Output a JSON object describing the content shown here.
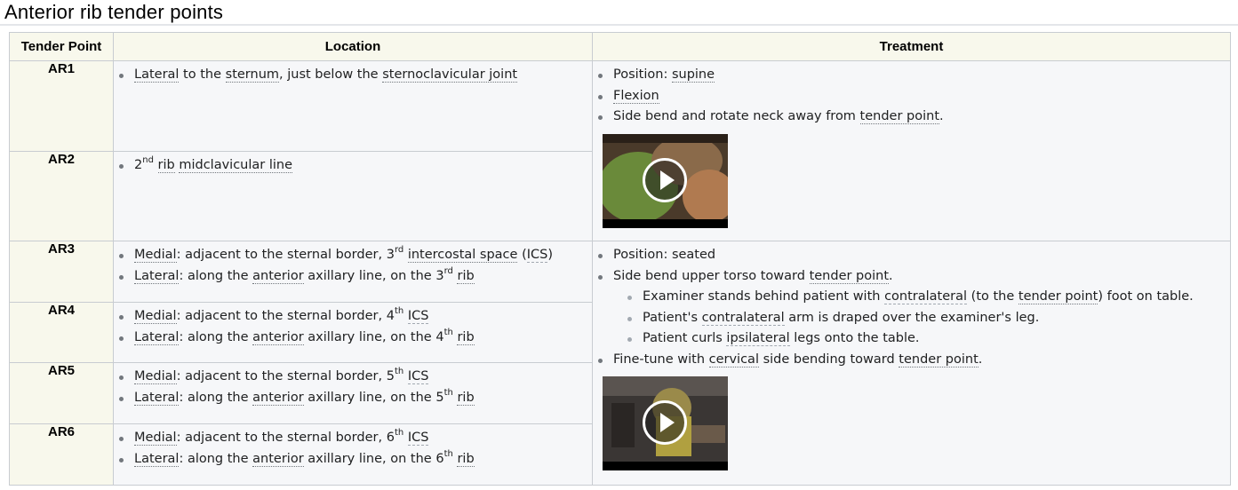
{
  "page": {
    "title": "Anterior rib tender points"
  },
  "table": {
    "headers": {
      "tender_point": "Tender Point",
      "location": "Location",
      "treatment": "Treatment"
    },
    "rows": [
      {
        "name": "AR1",
        "location": [
          {
            "parts": [
              "Lateral",
              " to the ",
              "sternum",
              ", just below the ",
              "sternoclavicular joint"
            ]
          }
        ]
      },
      {
        "name": "AR2",
        "location": [
          {
            "ordinal": "2",
            "suffix": "nd",
            "word1": "rib",
            "word2": "midclavicular line"
          }
        ]
      },
      {
        "name": "AR3",
        "location": [
          {
            "prefix": "Medial",
            "text": ": adjacent to the sternal border, ",
            "ordinal": "3",
            "suffix": "rd",
            "term": "intercostal space",
            "abbr": "ICS"
          },
          {
            "prefix": "Lateral",
            "text1": ": along the ",
            "term": "anterior",
            "text2": " axillary line, on the ",
            "ordinal": "3",
            "suffix": "rd",
            "end": "rib"
          }
        ]
      },
      {
        "name": "AR4",
        "location": [
          {
            "prefix": "Medial",
            "text": ": adjacent to the sternal border, ",
            "ordinal": "4",
            "suffix": "th",
            "abbr": "ICS"
          },
          {
            "prefix": "Lateral",
            "text1": ": along the ",
            "term": "anterior",
            "text2": " axillary line, on the ",
            "ordinal": "4",
            "suffix": "th",
            "end": "rib"
          }
        ]
      },
      {
        "name": "AR5",
        "location": [
          {
            "prefix": "Medial",
            "text": ": adjacent to the sternal border, ",
            "ordinal": "5",
            "suffix": "th",
            "abbr": "ICS"
          },
          {
            "prefix": "Lateral",
            "text1": ": along the ",
            "term": "anterior",
            "text2": " axillary line, on the ",
            "ordinal": "5",
            "suffix": "th",
            "end": "rib"
          }
        ]
      },
      {
        "name": "AR6",
        "location": [
          {
            "prefix": "Medial",
            "text": ": adjacent to the sternal border, ",
            "ordinal": "6",
            "suffix": "th",
            "abbr": "ICS"
          },
          {
            "prefix": "Lateral",
            "text1": ": along the ",
            "term": "anterior",
            "text2": " axillary line, on the ",
            "ordinal": "6",
            "suffix": "th",
            "end": "rib"
          }
        ]
      }
    ],
    "treatment_1": {
      "items": [
        {
          "a": "Position: ",
          "b": "supine"
        },
        {
          "b": "Flexion"
        },
        {
          "a": "Side bend and rotate neck away from ",
          "b": "tender point",
          "c": "."
        }
      ]
    },
    "treatment_2": {
      "position": "Position: seated",
      "side_bend": {
        "a": "Side bend upper torso toward ",
        "b": "tender point",
        "c": "."
      },
      "sub": [
        {
          "a": "Examiner stands behind patient with ",
          "b": "contralateral",
          "c": " (to the ",
          "d": "tender point",
          "e": ") foot on table."
        },
        {
          "a": "Patient's ",
          "b": "contralateral",
          "c": " arm is draped over the examiner's leg."
        },
        {
          "a": "Patient curls ",
          "b": "ipsilateral",
          "c": " legs onto the table."
        }
      ],
      "finetune": {
        "a": "Fine-tune with ",
        "b": "cervical",
        "c": " side bending toward ",
        "d": "tender point",
        "e": "."
      }
    }
  },
  "icons": {
    "video_play": "play-icon"
  },
  "colors": {
    "header_bg": "#f8f8ec",
    "cell_bg": "#f6f7f9",
    "border": "#c8ccd1"
  }
}
